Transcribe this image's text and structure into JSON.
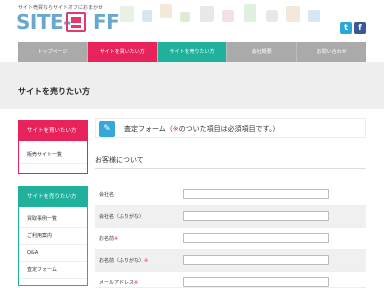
{
  "header": {
    "tagline": "サイト売買ならサイトオフにおまかせ",
    "logo_text_left": "SITE-",
    "logo_text_right": "FF",
    "social": {
      "twitter": "t",
      "facebook": "f"
    }
  },
  "nav": {
    "items": [
      {
        "label": "トップページ"
      },
      {
        "label": "サイトを買いたい方"
      },
      {
        "label": "サイトを売りたい方"
      },
      {
        "label": "会社概要"
      },
      {
        "label": "お問い合わせ"
      }
    ]
  },
  "page": {
    "title": "サイトを売りたい方"
  },
  "sidebar": {
    "buy": {
      "heading": "サイトを買いたい方",
      "links": [
        "販売サイト一覧"
      ]
    },
    "sell": {
      "heading": "サイトを売りたい方",
      "links": [
        "買取事例一覧",
        "ご利用案内",
        "Q&A",
        "査定フォーム"
      ]
    }
  },
  "form": {
    "title_prefix": "査定フォーム（",
    "title_req": "※",
    "title_suffix": "のついた項目は必須項目です。）",
    "section_title": "お客様について",
    "fields": [
      {
        "label": "会社名",
        "required": ""
      },
      {
        "label": "会社名（ふりがな）",
        "required": ""
      },
      {
        "label": "お名前",
        "required": "※"
      },
      {
        "label": "お名前（ふりがな）",
        "required": "※"
      },
      {
        "label": "メールアドレス",
        "required": "※"
      }
    ]
  },
  "colors": {
    "buy": "#e8225a",
    "sell": "#1fb19c",
    "accent": "#36a7d9"
  }
}
